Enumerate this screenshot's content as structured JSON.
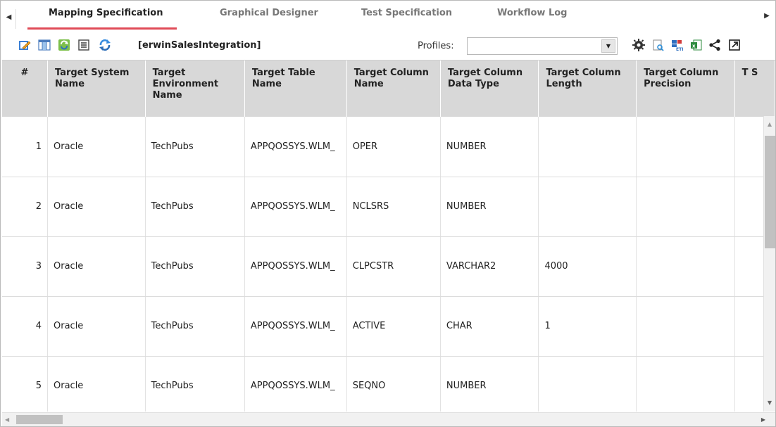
{
  "tabs": [
    {
      "label": "Mapping Specification",
      "active": true
    },
    {
      "label": "Graphical Designer",
      "active": false
    },
    {
      "label": "Test Specification",
      "active": false
    },
    {
      "label": "Workflow Log",
      "active": false
    }
  ],
  "toolbar": {
    "project_name": "[erwinSalesIntegration]",
    "profiles_label": "Profiles:",
    "profiles_value": "",
    "icons": [
      "edit-icon",
      "columns-icon",
      "sync-icon",
      "list-icon",
      "refresh-icon",
      "settings-gear-icon",
      "preview-icon",
      "etl-icon",
      "excel-icon",
      "share-icon",
      "popout-icon"
    ]
  },
  "grid": {
    "columns": [
      "#",
      "Target System Name",
      "Target Environment Name",
      "Target Table Name",
      "Target Column Name",
      "Target Column Data Type",
      "Target Column Length",
      "Target Column Precision",
      "T S"
    ],
    "rows": [
      [
        "1",
        "Oracle",
        "TechPubs",
        "APPQOSSYS.WLM_",
        "OPER",
        "NUMBER",
        "",
        "",
        ""
      ],
      [
        "2",
        "Oracle",
        "TechPubs",
        "APPQOSSYS.WLM_",
        "NCLSRS",
        "NUMBER",
        "",
        "",
        ""
      ],
      [
        "3",
        "Oracle",
        "TechPubs",
        "APPQOSSYS.WLM_",
        "CLPCSTR",
        "VARCHAR2",
        "4000",
        "",
        ""
      ],
      [
        "4",
        "Oracle",
        "TechPubs",
        "APPQOSSYS.WLM_",
        "ACTIVE",
        "CHAR",
        "1",
        "",
        ""
      ],
      [
        "5",
        "Oracle",
        "TechPubs",
        "APPQOSSYS.WLM_",
        "SEQNO",
        "NUMBER",
        "",
        "",
        ""
      ]
    ]
  },
  "colors": {
    "accent_underline": "#e04b57",
    "header_bg": "#d8d8d8"
  }
}
